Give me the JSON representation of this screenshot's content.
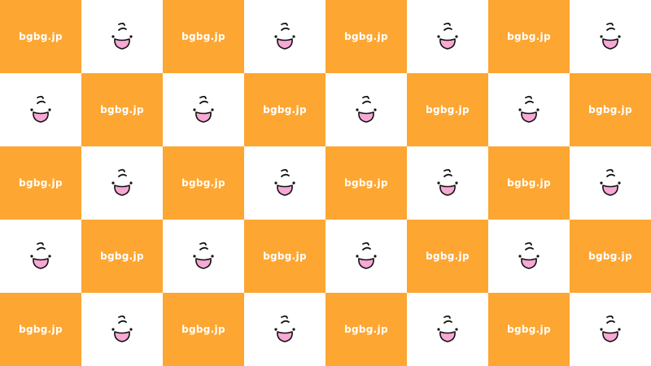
{
  "watermark_text": "bgbg.jp",
  "colors": {
    "orange": "#fda632",
    "white": "#ffffff",
    "mouth_fill": "#f7a8d4",
    "outline": "#111111"
  },
  "grid": {
    "rows": 5,
    "cols": 8,
    "pattern": "checkerboard; orange tiles show text, white tiles show face"
  },
  "icon": "smiling-face-icon"
}
